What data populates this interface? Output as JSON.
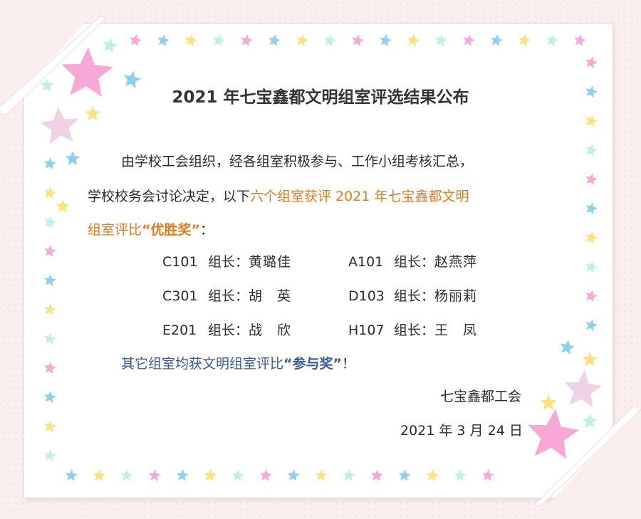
{
  "title": "2021 年七宝鑫都文明组室评选结果公布",
  "intro": {
    "line1": "由学校工会组织，经各组室积极参与、工作小组考核汇总，",
    "line2_plain": "学校校务会讨论决定，以下",
    "line2_orange": "六个组室获评 2021 年七宝鑫都文明",
    "line3_orange": "组室评比",
    "line3_award": "“优胜奖”",
    "line3_end": "："
  },
  "winners": [
    {
      "room": "C101",
      "leader_label": "组长：",
      "leader": "黄璐佳"
    },
    {
      "room": "A101",
      "leader_label": "组长：",
      "leader": "赵燕萍"
    },
    {
      "room": "C301",
      "leader_label": "组长：",
      "leader": "胡　英"
    },
    {
      "room": "D103",
      "leader_label": "组长：",
      "leader": "杨丽莉"
    },
    {
      "room": "E201",
      "leader_label": "组长：",
      "leader": "战　欣"
    },
    {
      "room": "H107",
      "leader_label": "组长：",
      "leader": "王　凤"
    }
  ],
  "others": {
    "text": "其它组室均获文明组室评比",
    "award": "“参与奖”",
    "end": "！"
  },
  "signature": {
    "org": "七宝鑫都工会",
    "date": "2021 年 3 月 24 日"
  },
  "colors": {
    "orange": "#e07a1e",
    "blue": "#375c97",
    "star_pink": "#f7a8d6",
    "star_blue": "#8fd0f0",
    "star_yellow": "#fbe27a",
    "star_mint": "#bff0e6"
  }
}
